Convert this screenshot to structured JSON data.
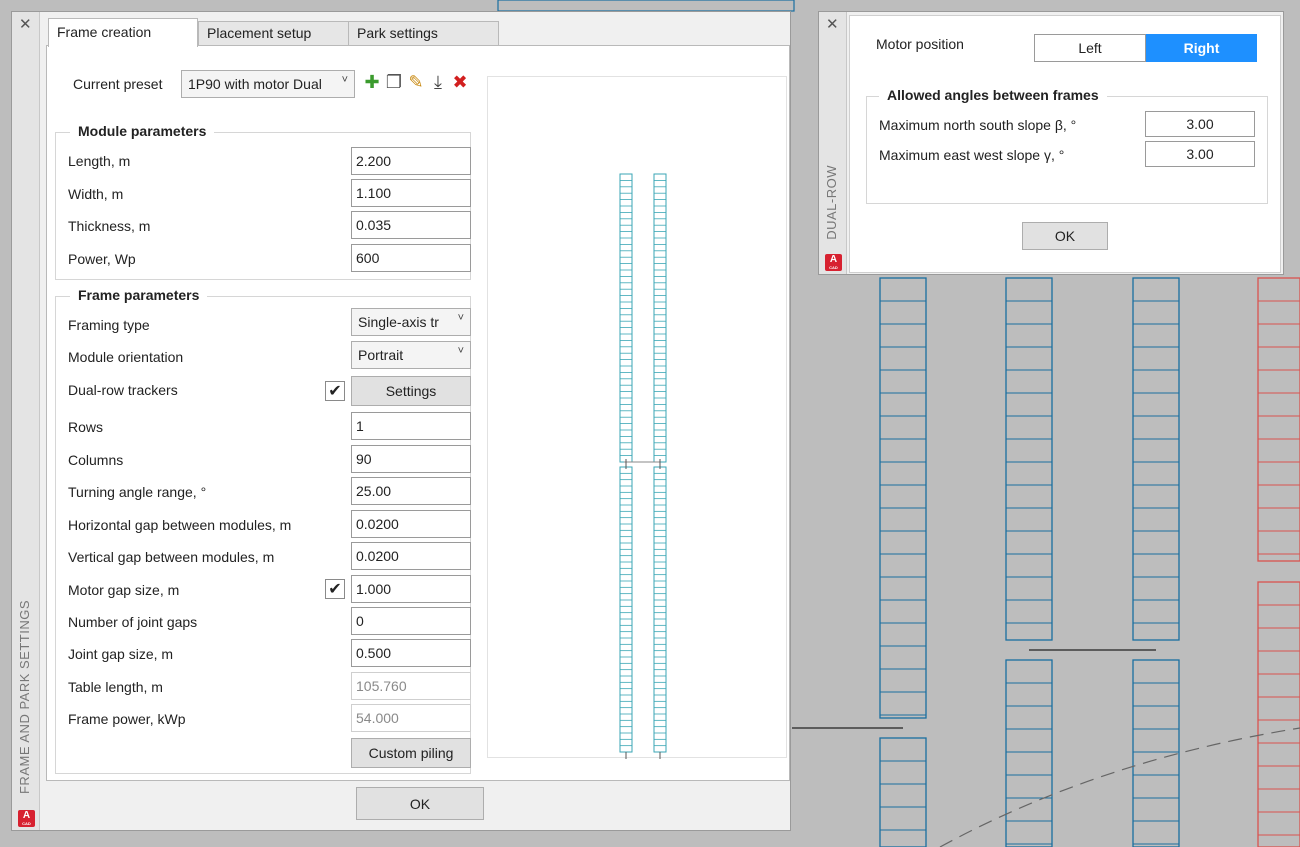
{
  "frame_panel": {
    "side_title": "FRAME AND PARK SETTINGS",
    "logo": "A",
    "logo_sub": "CAD",
    "tabs": [
      {
        "label": "Frame creation",
        "active": true
      },
      {
        "label": "Placement setup",
        "active": false
      },
      {
        "label": "Park settings",
        "active": false
      }
    ],
    "preset_label": "Current preset",
    "preset_value": "1P90 with motor Dual",
    "preset_icons": [
      "add-icon",
      "copy-icon",
      "edit-icon",
      "download-icon",
      "delete-icon"
    ],
    "module": {
      "title": "Module parameters",
      "length_label": "Length, m",
      "length_value": "2.200",
      "width_label": "Width, m",
      "width_value": "1.100",
      "thickness_label": "Thickness, m",
      "thickness_value": "0.035",
      "power_label": "Power, Wp",
      "power_value": "600"
    },
    "frame": {
      "title": "Frame parameters",
      "framing_type_label": "Framing type",
      "framing_type_value": "Single-axis tr",
      "orientation_label": "Module orientation",
      "orientation_value": "Portrait",
      "dual_row_label": "Dual-row trackers",
      "dual_row_checked": true,
      "settings_button": "Settings",
      "rows_label": "Rows",
      "rows_value": "1",
      "columns_label": "Columns",
      "columns_value": "90",
      "turning_label": "Turning angle range, °",
      "turning_value": "25.00",
      "hgap_label": "Horizontal gap between modules, m",
      "hgap_value": "0.0200",
      "vgap_label": "Vertical gap between modules, m",
      "vgap_value": "0.0200",
      "motor_gap_label": "Motor gap size, m",
      "motor_gap_checked": true,
      "motor_gap_value": "1.000",
      "joint_gaps_label": "Number of joint gaps",
      "joint_gaps_value": "0",
      "joint_gap_size_label": "Joint gap size, m",
      "joint_gap_size_value": "0.500",
      "table_length_label": "Table length, m",
      "table_length_value": "105.760",
      "frame_power_label": "Frame power, kWp",
      "frame_power_value": "54.000",
      "custom_piling_button": "Custom piling"
    },
    "ok_button": "OK"
  },
  "dual_row_panel": {
    "side_title": "DUAL-ROW",
    "logo": "A",
    "logo_sub": "CAD",
    "motor_position_label": "Motor position",
    "motor_left": "Left",
    "motor_right": "Right",
    "motor_selected": "Right",
    "angles_title": "Allowed angles between frames",
    "ns_label": "Maximum north south slope β, °",
    "ns_value": "3.00",
    "ew_label": "Maximum east west slope γ, °",
    "ew_value": "3.00",
    "ok_button": "OK"
  },
  "colors": {
    "accent": "#1e90ff",
    "tracker_blue": "#1a6fa0",
    "tracker_red": "#d9534f",
    "preview_teal": "#3aa6b5"
  }
}
